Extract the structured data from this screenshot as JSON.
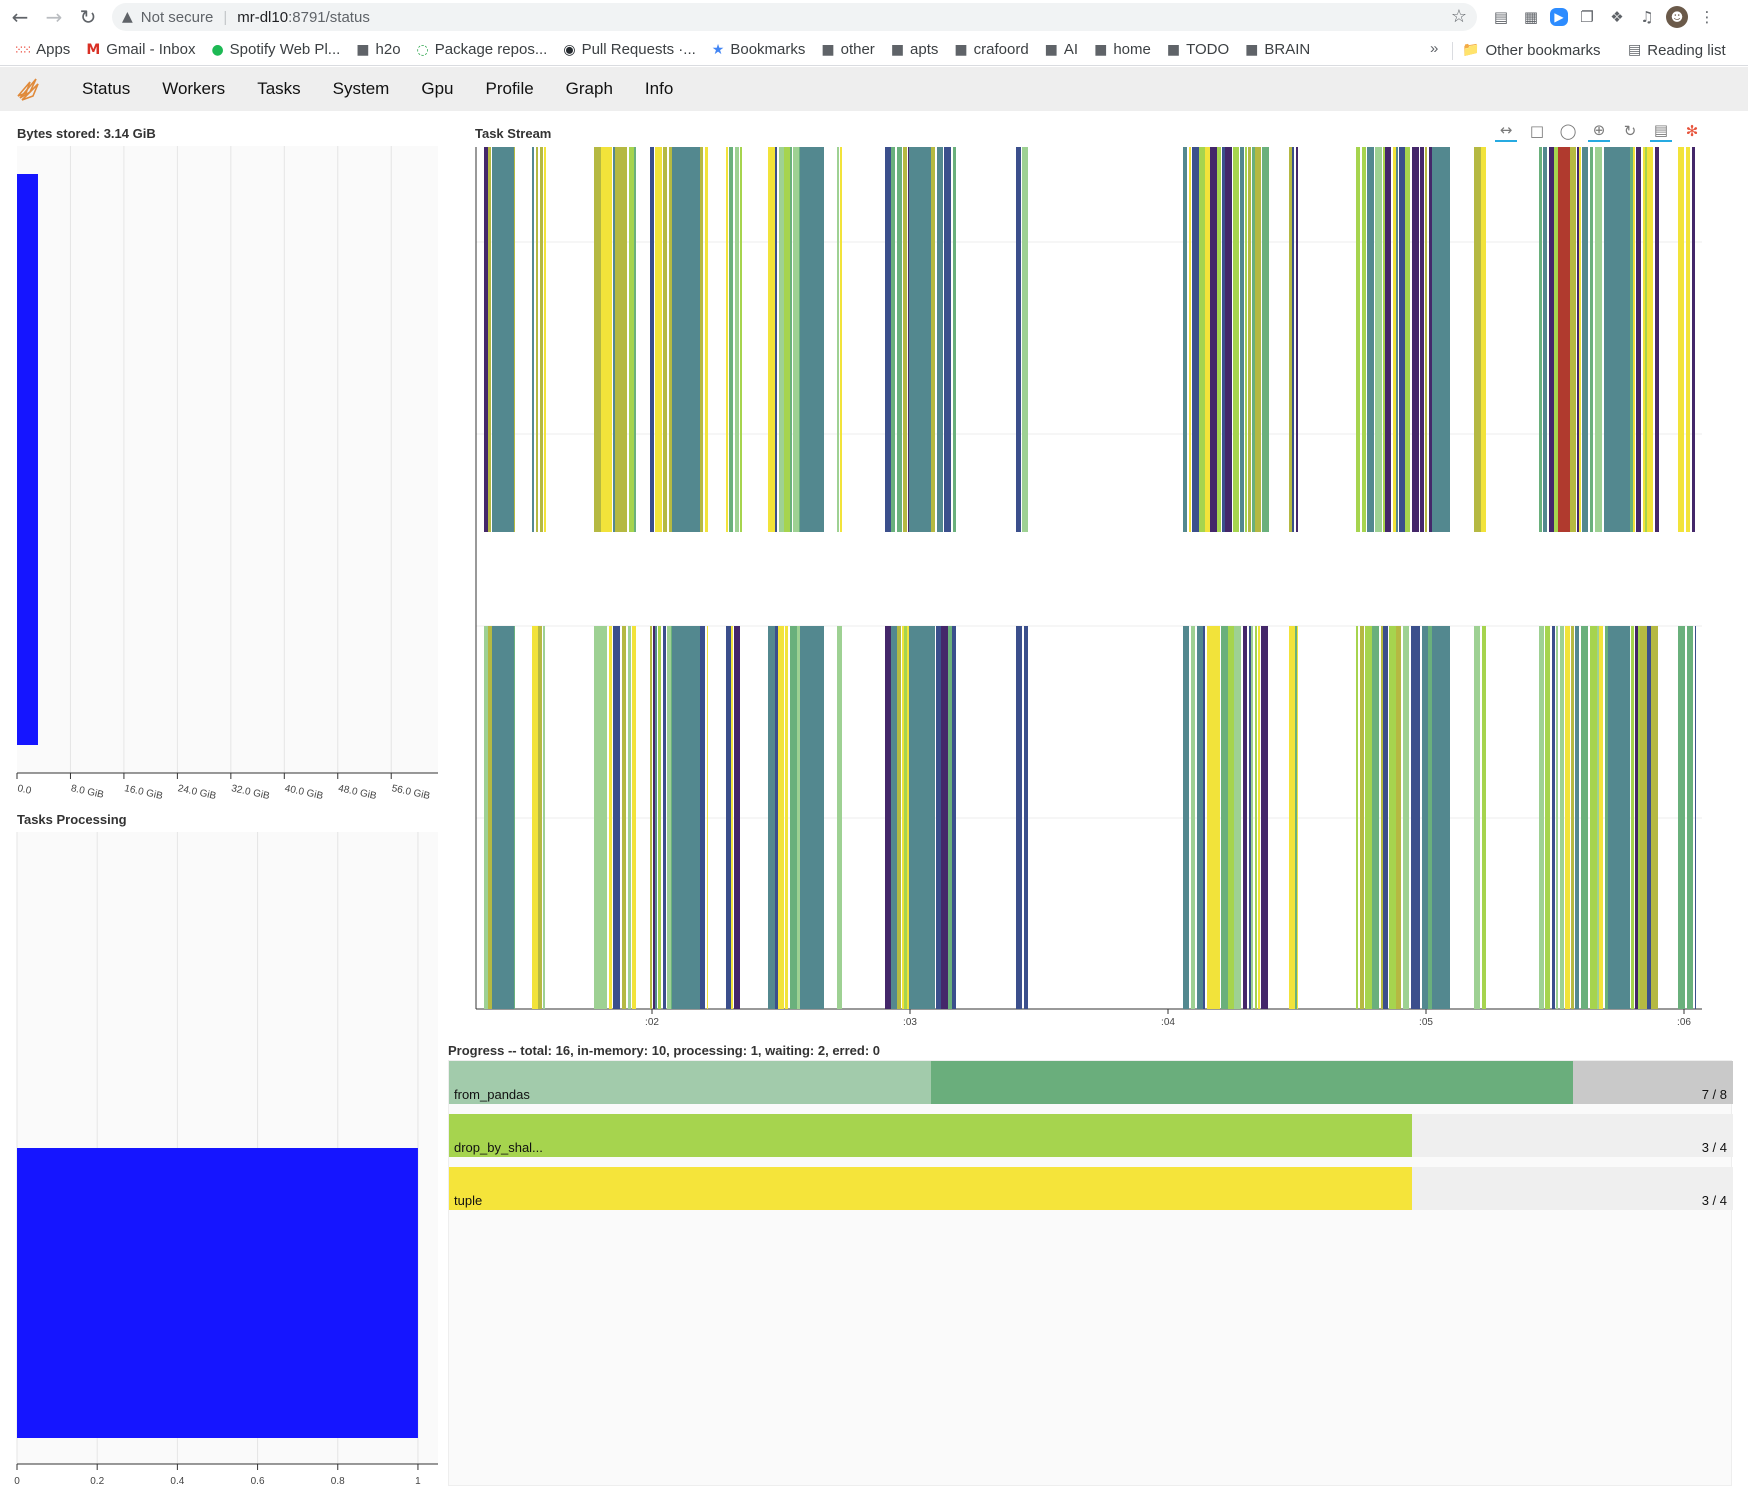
{
  "browser": {
    "not_secure": "Not secure",
    "url_host": "mr-dl10",
    "url_path": ":8791/status",
    "bookmarks": [
      {
        "label": "Apps",
        "icon": "apps-grid-icon"
      },
      {
        "label": "Gmail - Inbox",
        "icon": "gmail-icon"
      },
      {
        "label": "Spotify Web Pl...",
        "icon": "spotify-icon"
      },
      {
        "label": "h2o",
        "icon": "folder-icon"
      },
      {
        "label": "Package repos...",
        "icon": "package-icon"
      },
      {
        "label": "Pull Requests ·...",
        "icon": "github-icon"
      },
      {
        "label": "Bookmarks",
        "icon": "star-icon"
      },
      {
        "label": "other",
        "icon": "folder-icon"
      },
      {
        "label": "apts",
        "icon": "folder-icon"
      },
      {
        "label": "crafoord",
        "icon": "folder-icon"
      },
      {
        "label": "AI",
        "icon": "folder-icon"
      },
      {
        "label": "home",
        "icon": "folder-icon"
      },
      {
        "label": "TODO",
        "icon": "folder-icon"
      },
      {
        "label": "BRAIN",
        "icon": "folder-icon"
      }
    ],
    "more_chevron": "»",
    "other_bookmarks": "Other bookmarks",
    "reading_list": "Reading list"
  },
  "nav": {
    "items": [
      "Status",
      "Workers",
      "Tasks",
      "System",
      "Gpu",
      "Profile",
      "Graph",
      "Info"
    ]
  },
  "bytes_stored": {
    "title": "Bytes stored: 3.14 GiB",
    "value_gib": 3.14,
    "bar_color": "#1515ff",
    "ticks": [
      "0.0",
      "8.0 GiB",
      "16.0 GiB",
      "24.0 GiB",
      "32.0 GiB",
      "40.0 GiB",
      "48.0 GiB",
      "56.0 GiB"
    ]
  },
  "tasks_processing": {
    "title": "Tasks Processing",
    "value": 1,
    "bar_color": "#1515ff",
    "ticks": [
      "0",
      "0.2",
      "0.4",
      "0.6",
      "0.8",
      "1"
    ]
  },
  "task_stream": {
    "title": "Task Stream",
    "x_ticks": [
      ":02",
      ":03",
      ":04",
      ":05",
      ":06"
    ],
    "palette": {
      "teal": "#53888f",
      "green": "#6ab07c",
      "lime": "#a6d44e",
      "yellow": "#f2e33a",
      "olive": "#b5b942",
      "purple": "#44276a",
      "navy": "#3b4f8c",
      "red": "#b03a2e",
      "light": "#9ed193"
    },
    "tools": [
      "pan-icon",
      "box-zoom-icon",
      "wheel-zoom-icon",
      "zoom-in-icon",
      "reset-icon",
      "hover-icon",
      "bokeh-logo-icon"
    ]
  },
  "progress": {
    "title": "Progress -- total: 16, in-memory: 10, processing: 1, waiting: 2, erred: 0",
    "bars": [
      {
        "name": "from_pandas",
        "fraction": "7 / 8",
        "released": 3,
        "memory": 4,
        "total": 8,
        "released_color": "#a2cbab",
        "memory_color": "#6aae7c",
        "remaining_color": "#c9c9c9"
      },
      {
        "name": "drop_by_shal...",
        "fraction": "3 / 4",
        "released": 0,
        "memory": 3,
        "total": 4,
        "released_color": "#c8e48e",
        "memory_color": "#a6d44e",
        "remaining_color": "#efefef"
      },
      {
        "name": "tuple",
        "fraction": "3 / 4",
        "released": 0,
        "memory": 3,
        "total": 4,
        "released_color": "#f7ee8e",
        "memory_color": "#f5e43a",
        "remaining_color": "#efefef"
      }
    ]
  }
}
